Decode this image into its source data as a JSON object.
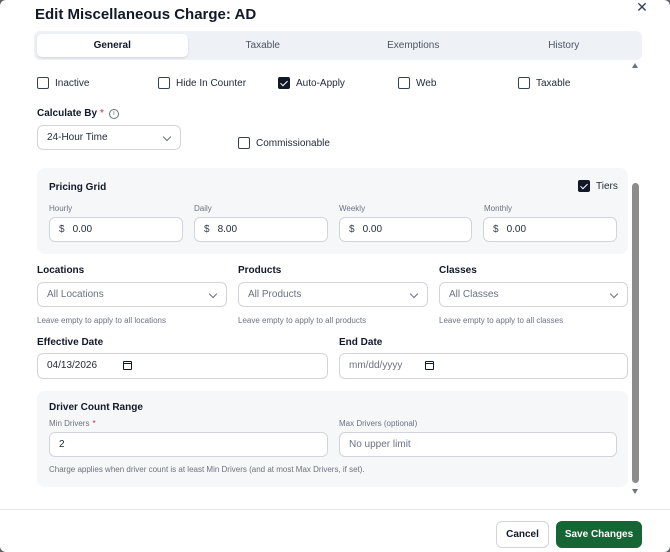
{
  "dialog": {
    "title": "Edit Miscellaneous Charge: AD",
    "close_glyph": "✕"
  },
  "tabs": [
    {
      "label": "General",
      "active": true
    },
    {
      "label": "Taxable",
      "active": false
    },
    {
      "label": "Exemptions",
      "active": false
    },
    {
      "label": "History",
      "active": false
    }
  ],
  "options": {
    "inactive": {
      "label": "Inactive",
      "checked": false
    },
    "hide_in_counter": {
      "label": "Hide In Counter",
      "checked": false
    },
    "auto_apply": {
      "label": "Auto-Apply",
      "checked": true
    },
    "web": {
      "label": "Web",
      "checked": false
    },
    "taxable": {
      "label": "Taxable",
      "checked": false
    }
  },
  "calculate_by": {
    "label": "Calculate By",
    "required_mark": "*",
    "info_glyph": "i",
    "value": "24-Hour Time"
  },
  "commissionable": {
    "label": "Commissionable",
    "checked": false
  },
  "pricing_grid": {
    "title": "Pricing Grid",
    "tiers": {
      "label": "Tiers",
      "checked": true
    },
    "currency_symbol": "$",
    "fields": [
      {
        "label": "Hourly",
        "value": "0.00"
      },
      {
        "label": "Daily",
        "value": "8.00"
      },
      {
        "label": "Weekly",
        "value": "0.00"
      },
      {
        "label": "Monthly",
        "value": "0.00"
      }
    ]
  },
  "scopes": {
    "locations": {
      "label": "Locations",
      "placeholder": "All Locations",
      "help": "Leave empty to apply to all locations"
    },
    "products": {
      "label": "Products",
      "placeholder": "All Products",
      "help": "Leave empty to apply to all products"
    },
    "classes": {
      "label": "Classes",
      "placeholder": "All Classes",
      "help": "Leave empty to apply to all classes"
    }
  },
  "dates": {
    "effective": {
      "label": "Effective Date",
      "value": "04/13/2026"
    },
    "end": {
      "label": "End Date",
      "placeholder": "mm/dd/yyyy"
    }
  },
  "driver_count": {
    "title": "Driver Count Range",
    "min": {
      "label": "Min Drivers",
      "required_mark": "*",
      "value": "2"
    },
    "max": {
      "label": "Max Drivers (optional)",
      "placeholder": "No upper limit"
    },
    "note": "Charge applies when driver count is at least Min Drivers (and at most Max Drivers, if set)."
  },
  "footer": {
    "cancel_label": "Cancel",
    "save_label": "Save Changes"
  },
  "colors": {
    "primary": "#166534",
    "required": "#dc2626"
  }
}
